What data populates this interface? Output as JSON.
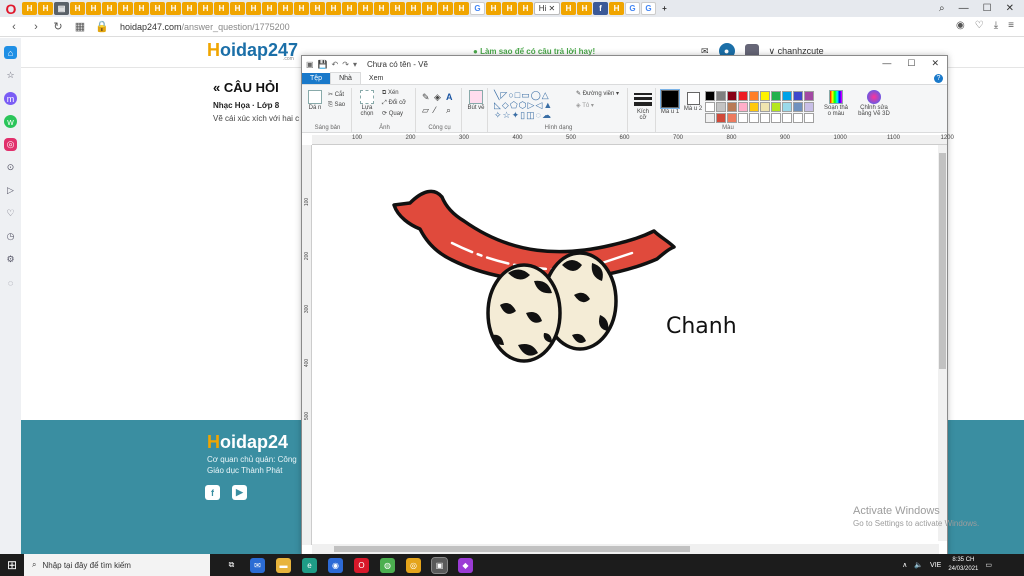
{
  "browser": {
    "tabs": [
      "H",
      "H",
      "doc",
      "H",
      "H",
      "H",
      "H",
      "H",
      "H",
      "H",
      "H",
      "H",
      "H",
      "H",
      "H",
      "H",
      "H",
      "H",
      "H",
      "H",
      "H",
      "H",
      "H",
      "H",
      "H",
      "H",
      "H",
      "H",
      "G",
      "H",
      "H",
      "H"
    ],
    "active_tab_title": "Hi",
    "tabs_after": [
      "H",
      "H",
      "fb",
      "H",
      "G",
      "G"
    ],
    "new_tab": "+",
    "url_host": "hoidap247.com",
    "url_path": "/answer_question/1775200",
    "window_controls": [
      "search-icon",
      "minimize-icon",
      "maximize-icon",
      "close-icon"
    ]
  },
  "site": {
    "logo": "oidap247",
    "logo_initial": "H",
    "logo_sub": ".com",
    "ask_banner": "Làm sao để có câu trả lời hay!",
    "username": "chanhzcute",
    "question_heading": "CÂU HỎI",
    "question_meta": "Nhạc Họa · Lớp 8",
    "question_text": "Vẽ cái xúc xích với hai c",
    "footer_logo_initial": "H",
    "footer_logo": "oidap24",
    "footer_line1": "Cơ quan chủ quản: Công",
    "footer_line2": "Giáo dục Thành Phát"
  },
  "paint": {
    "title": "Chưa có tên - Vẽ",
    "tabs": {
      "file": "Tệp",
      "home": "Nhà",
      "view": "Xem"
    },
    "groups": {
      "clipboard": "Sáng bản",
      "image": "Ảnh",
      "tools": "Công cụ",
      "shapes": "Hình dạng",
      "colors": "Màu"
    },
    "buttons": {
      "paste": "Dá n",
      "cut": "Cắt",
      "copy": "Sao",
      "select": "Lựa chọn",
      "crop": "Xén",
      "resize": "Đổi cỡ",
      "rotate": "Quay",
      "brushes": "Bút vẽ",
      "outline": "Đường viền",
      "fill": "Tô",
      "size": "Kích cỡ",
      "color1": "Mà u 1",
      "color2": "Mà u 2",
      "edit_colors": "Soạn thả o màu",
      "paint3d": "Chỉnh sửa bằng Vẽ 3D"
    },
    "palette": [
      "#000000",
      "#7f7f7f",
      "#880015",
      "#ed1c24",
      "#ff7f27",
      "#fff200",
      "#22b14c",
      "#00a2e8",
      "#3f48cc",
      "#a349a4",
      "#ffffff",
      "#c3c3c3",
      "#b97a57",
      "#ffaec9",
      "#ffc90e",
      "#efe4b0",
      "#b5e61d",
      "#99d9ea",
      "#7092be",
      "#c8bfe7",
      "#f0f0f0",
      "#d04a3a",
      "#ed7a5e",
      "#ffffff",
      "#ffffff",
      "#ffffff",
      "#ffffff",
      "#ffffff",
      "#ffffff",
      "#ffffff"
    ],
    "color1": "#000000",
    "color2": "#ffffff",
    "ruler_h": [
      "100",
      "200",
      "300",
      "400",
      "500",
      "600",
      "700",
      "800",
      "900",
      "1000",
      "1100",
      "1200"
    ],
    "ruler_v": [
      "100",
      "200",
      "300",
      "400",
      "500"
    ],
    "drawing_text": "Chanh"
  },
  "activate": {
    "line1": "Activate Windows",
    "line2": "Go to Settings to activate Windows."
  },
  "taskbar": {
    "search_placeholder": "Nhập tại đây để tìm kiếm",
    "time": "8:35 CH",
    "date": "24/03/2021",
    "lang": "VIE"
  }
}
